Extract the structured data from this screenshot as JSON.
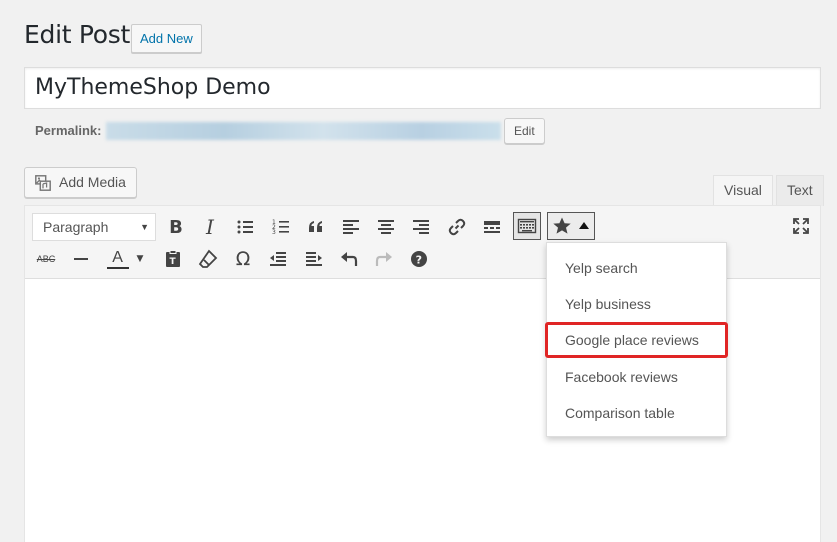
{
  "header": {
    "title": "Edit Post",
    "add_new": "Add New"
  },
  "post": {
    "title_value": "MyThemeShop Demo"
  },
  "permalink": {
    "label": "Permalink:",
    "edit": "Edit"
  },
  "media": {
    "add_media": "Add Media",
    "icon": "add-media-icon"
  },
  "editor_tabs": [
    {
      "label": "Visual",
      "active": true
    },
    {
      "label": "Text",
      "active": false
    }
  ],
  "toolbar": {
    "format_select": "Paragraph",
    "row1_icons": [
      "bold-icon",
      "italic-icon",
      "bulleted-list-icon",
      "numbered-list-icon",
      "blockquote-icon",
      "align-left-icon",
      "align-center-icon",
      "align-right-icon",
      "insert-link-icon",
      "read-more-icon",
      "toolbar-toggle-icon",
      "star-icon",
      "fullscreen-icon"
    ],
    "row2_icons": [
      "strikethrough-icon",
      "horizontal-line-icon",
      "text-color-icon",
      "paste-as-text-icon",
      "clear-formatting-icon",
      "special-character-icon",
      "outdent-icon",
      "indent-icon",
      "undo-icon",
      "redo-icon",
      "help-icon"
    ],
    "bold": "B",
    "italic": "I",
    "strike": "ABC",
    "text_color_letter": "A",
    "omega": "Ω"
  },
  "dropdown": {
    "items": [
      "Yelp search",
      "Yelp business",
      "Google place reviews",
      "Facebook reviews",
      "Comparison table"
    ],
    "highlighted_index": 2,
    "highlight_color": "#e02525"
  },
  "colors": {
    "link": "#0073aa",
    "background": "#f1f1f1",
    "toolbar": "#f5f5f5"
  }
}
